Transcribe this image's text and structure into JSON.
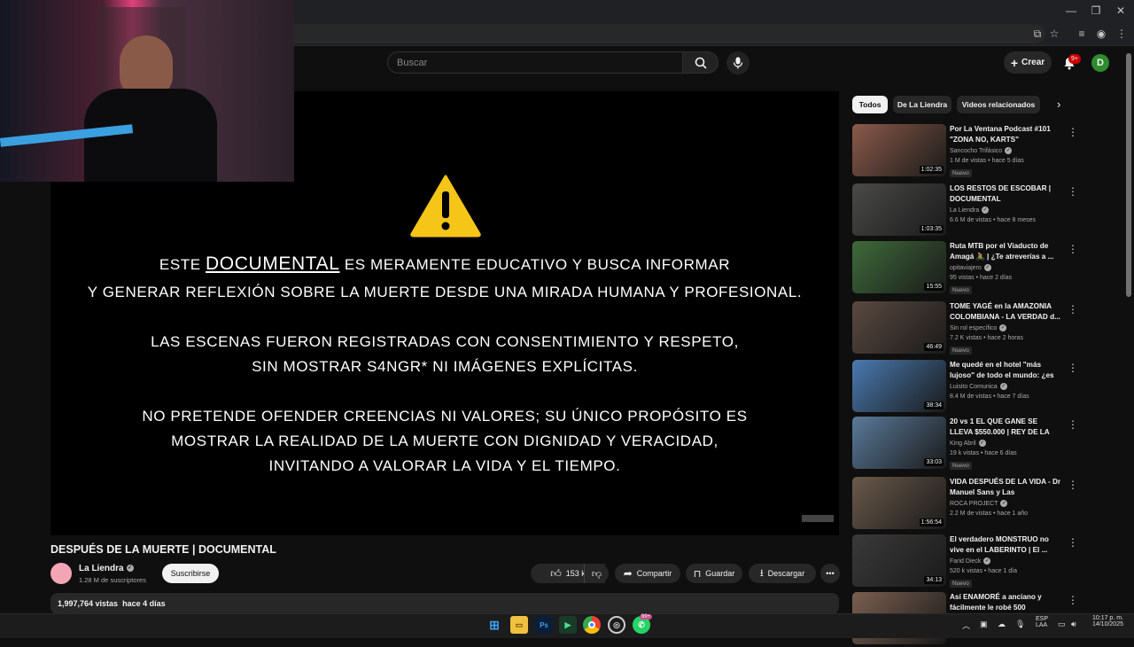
{
  "browser": {
    "icons": [
      "cast-icon",
      "star-icon",
      "queue-icon",
      "profile-icon",
      "more-icon"
    ]
  },
  "header": {
    "search_placeholder": "Buscar",
    "create_label": "Crear",
    "notif_count": "9+",
    "avatar_letter": "D"
  },
  "video": {
    "overlay": {
      "line1_pre": "ESTE",
      "line1_doc": "DOCUMENTAL",
      "line1_post": "ES MERAMENTE EDUCATIVO Y BUSCA INFORMAR",
      "line2": "Y GENERAR REFLEXIÓN SOBRE LA MUERTE DESDE UNA MIRADA HUMANA Y PROFESIONAL.",
      "line3": "LAS ESCENAS FUERON REGISTRADAS CON CONSENTIMIENTO Y RESPETO,",
      "line4": "SIN MOSTRAR S4NGR* NI IMÁGENES EXPLÍCITAS.",
      "line5": "NO PRETENDE OFENDER CREENCIAS NI VALORES; SU ÚNICO PROPÓSITO ES",
      "line6": "MOSTRAR LA REALIDAD DE LA MUERTE CON DIGNIDAD Y VERACIDAD,",
      "line7": "INVITANDO A VALORAR LA VIDA Y EL TIEMPO."
    },
    "title": "DESPUÉS DE LA MUERTE | DOCUMENTAL",
    "channel": "La Liendra",
    "subscribers": "1.28 M de suscriptores",
    "subscribe_label": "Suscribirse",
    "likes": "153 k",
    "share_label": "Compartir",
    "save_label": "Guardar",
    "download_label": "Descargar",
    "views": "1,997,764 vistas",
    "posted": "hace 4 días"
  },
  "sidebar": {
    "chips": [
      "Todos",
      "De La Liendra",
      "Videos relacionados"
    ],
    "recs": [
      {
        "title": "Por La Ventana Podcast #101 \"ZONA NO, KARTS\"",
        "channel": "Sancocho Trifásico",
        "meta": "1 M de vistas • hace 5 días",
        "duration": "1:02:35",
        "badge": "Nuevo",
        "thumb": "#8a5a4a"
      },
      {
        "title": "LOS RESTOS DE ESCOBAR | DOCUMENTAL",
        "channel": "La Liendra",
        "meta": "6.6 M de vistas • hace 8 meses",
        "duration": "1:03:35",
        "badge": "",
        "thumb": "#4a4a48"
      },
      {
        "title": "Ruta MTB por el Viaducto de Amagá 🚴 | ¿Te atreverías a ...",
        "channel": "opitaviajero",
        "meta": "95 vistas • hace 2 días",
        "duration": "15:55",
        "badge": "Nuevo",
        "thumb": "#3f6a3a"
      },
      {
        "title": "TOME YAGÉ en la AMAZONIA COLOMBIANA - LA VERDAD d...",
        "channel": "Sin rol específico",
        "meta": "7.2 K vistas • hace 2 horas",
        "duration": "46:49",
        "badge": "Nuevo",
        "thumb": "#5a4a40"
      },
      {
        "title": "Me quedé en el hotel \"más lujoso\" de todo el mundo: ¿es ...",
        "channel": "Luisito Comunica",
        "meta": "8.4 M de vistas • hace 7 días",
        "duration": "38:34",
        "badge": "",
        "thumb": "#4a7ab0"
      },
      {
        "title": "20 vs 1 EL QUE GANE SE LLEVA $550.000 | REY DE LA CALLE",
        "channel": "King Abril",
        "meta": "19 k vistas • hace 6 días",
        "duration": "33:03",
        "badge": "Nuevo",
        "thumb": "#5a7a9a"
      },
      {
        "title": "VIDA DESPUÉS DE LA VIDA - Dr Manuel Sans y Las Experiencia...",
        "channel": "ROCA PROJECT",
        "meta": "2.2 M de vistas • hace 1 año",
        "duration": "1:56:54",
        "badge": "",
        "thumb": "#6a5a4a"
      },
      {
        "title": "El verdadero MONSTRUO no vive en el LABERINTO | El ...",
        "channel": "Farid Dieck",
        "meta": "520 k vistas • hace 1 día",
        "duration": "34:13",
        "badge": "Nuevo",
        "thumb": "#3a3a3a"
      },
      {
        "title": "Así ENAMORÉ a anciano y fácilmente le robé 500",
        "channel": "",
        "meta": "",
        "duration": "",
        "badge": "",
        "thumb": "#7a6050"
      }
    ]
  },
  "taskbar": {
    "lang1": "ESP",
    "lang2": "LAA",
    "time": "10:17 p. m.",
    "date": "14/10/2025",
    "apps": [
      "windows-start",
      "file-explorer",
      "photoshop",
      "app-green",
      "chrome",
      "app-obs",
      "whatsapp"
    ],
    "whatsapp_badge": "99+"
  }
}
